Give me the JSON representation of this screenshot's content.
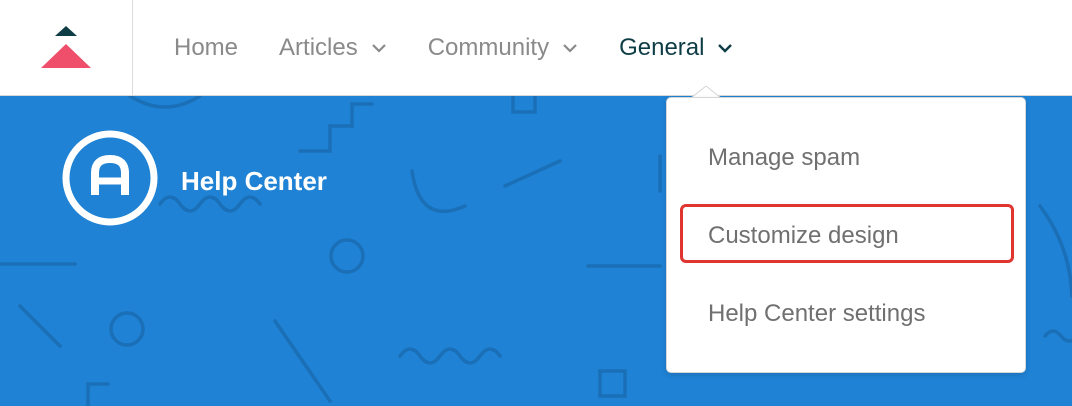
{
  "nav": {
    "items": [
      {
        "label": "Home",
        "has_dropdown": false
      },
      {
        "label": "Articles",
        "has_dropdown": true
      },
      {
        "label": "Community",
        "has_dropdown": true
      },
      {
        "label": "General",
        "has_dropdown": true,
        "active": true
      }
    ]
  },
  "brand": {
    "title": "Help Center",
    "logo_letter": "A",
    "banner_color": "#1f82d4",
    "logo_colors": {
      "top": "#0f3d46",
      "bottom": "#ef4f6b"
    }
  },
  "dropdown": {
    "items": [
      {
        "label": "Manage spam"
      },
      {
        "label": "Customize design",
        "highlighted": true
      },
      {
        "label": "Help Center settings"
      }
    ],
    "highlight_color": "#e0352f"
  }
}
